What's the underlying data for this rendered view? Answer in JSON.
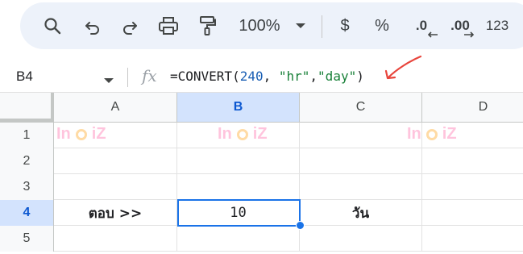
{
  "toolbar": {
    "zoom": "100%",
    "currency": "$",
    "percent": "%",
    "decrease_decimal": ".0",
    "increase_decimal": ".00",
    "more_formats": "123"
  },
  "formula_bar": {
    "cell_ref": "B4",
    "fx": "fx",
    "formula_prefix": "=CONVERT(",
    "formula_num": "240",
    "formula_sep1": ", ",
    "formula_str1": "\"hr\"",
    "formula_sep2": ",",
    "formula_str2": "\"day\"",
    "formula_suffix": ")"
  },
  "columns": [
    "A",
    "B",
    "C",
    "D"
  ],
  "rows": [
    "1",
    "2",
    "3",
    "4",
    "5"
  ],
  "cells": {
    "A4": "ตอบ >>",
    "B4": "10",
    "C4": "วัน"
  },
  "watermark": {
    "brand_left": "In",
    "brand_right": "iZ"
  },
  "colors": {
    "selection": "#1a73e8",
    "header_selected": "#d3e3fd",
    "toolbar_bg": "#edf2fa",
    "annotation_arrow": "#e8453c"
  }
}
